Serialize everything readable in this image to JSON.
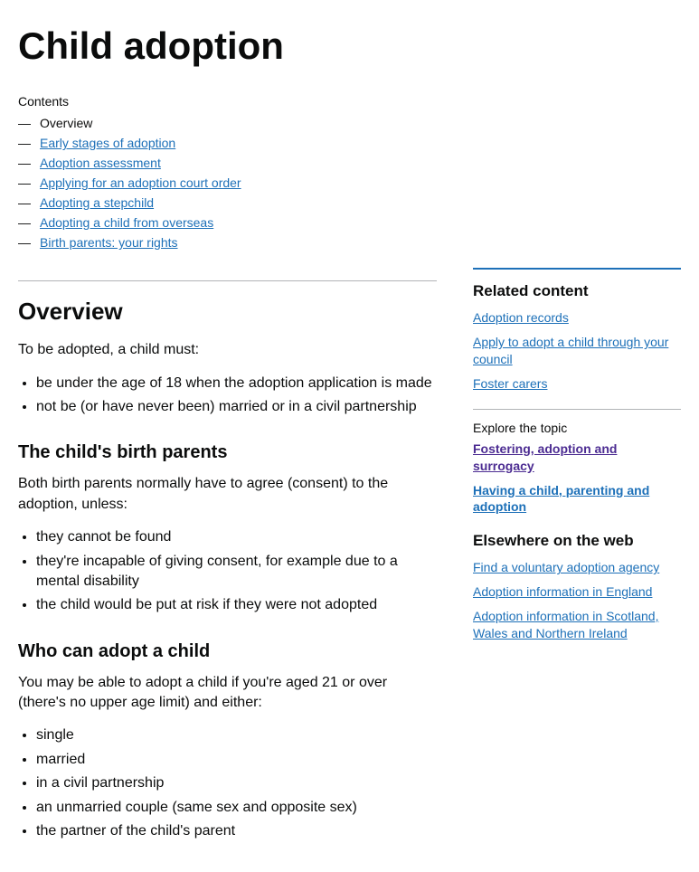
{
  "title": "Child adoption",
  "contentsLabel": "Contents",
  "contents": [
    {
      "label": "Overview",
      "current": true
    },
    {
      "label": "Early stages of adoption",
      "current": false
    },
    {
      "label": "Adoption assessment",
      "current": false
    },
    {
      "label": "Applying for an adoption court order",
      "current": false
    },
    {
      "label": "Adopting a stepchild",
      "current": false
    },
    {
      "label": "Adopting a child from overseas",
      "current": false
    },
    {
      "label": "Birth parents: your rights",
      "current": false
    }
  ],
  "main": {
    "overview": {
      "heading": "Overview",
      "intro": "To be adopted, a child must:",
      "bullets": [
        "be under the age of 18 when the adoption application is made",
        "not be (or have never been) married or in a civil partnership"
      ]
    },
    "birthParents": {
      "heading": "The child's birth parents",
      "intro": "Both birth parents normally have to agree (consent) to the adoption, unless:",
      "bullets": [
        "they cannot be found",
        "they're incapable of giving consent, for example due to a mental disability",
        "the child would be put at risk if they were not adopted"
      ]
    },
    "whoCanAdopt": {
      "heading": "Who can adopt a child",
      "intro": "You may be able to adopt a child if you're aged 21 or over (there's no upper age limit) and either:",
      "bullets": [
        "single",
        "married",
        "in a civil partnership",
        "an unmarried couple (same sex and opposite sex)",
        "the partner of the child's parent"
      ]
    }
  },
  "sidebar": {
    "relatedHeading": "Related content",
    "relatedLinks": [
      "Adoption records",
      "Apply to adopt a child through your council",
      "Foster carers"
    ],
    "exploreLabel": "Explore the topic",
    "exploreLinks": [
      {
        "label": "Fostering, adoption and surrogacy",
        "visited": true
      },
      {
        "label": "Having a child, parenting and adoption",
        "visited": false
      }
    ],
    "elsewhereHeading": "Elsewhere on the web",
    "elsewhereLinks": [
      "Find a voluntary adoption agency",
      "Adoption information in England",
      "Adoption information in Scotland, Wales and Northern Ireland"
    ]
  }
}
